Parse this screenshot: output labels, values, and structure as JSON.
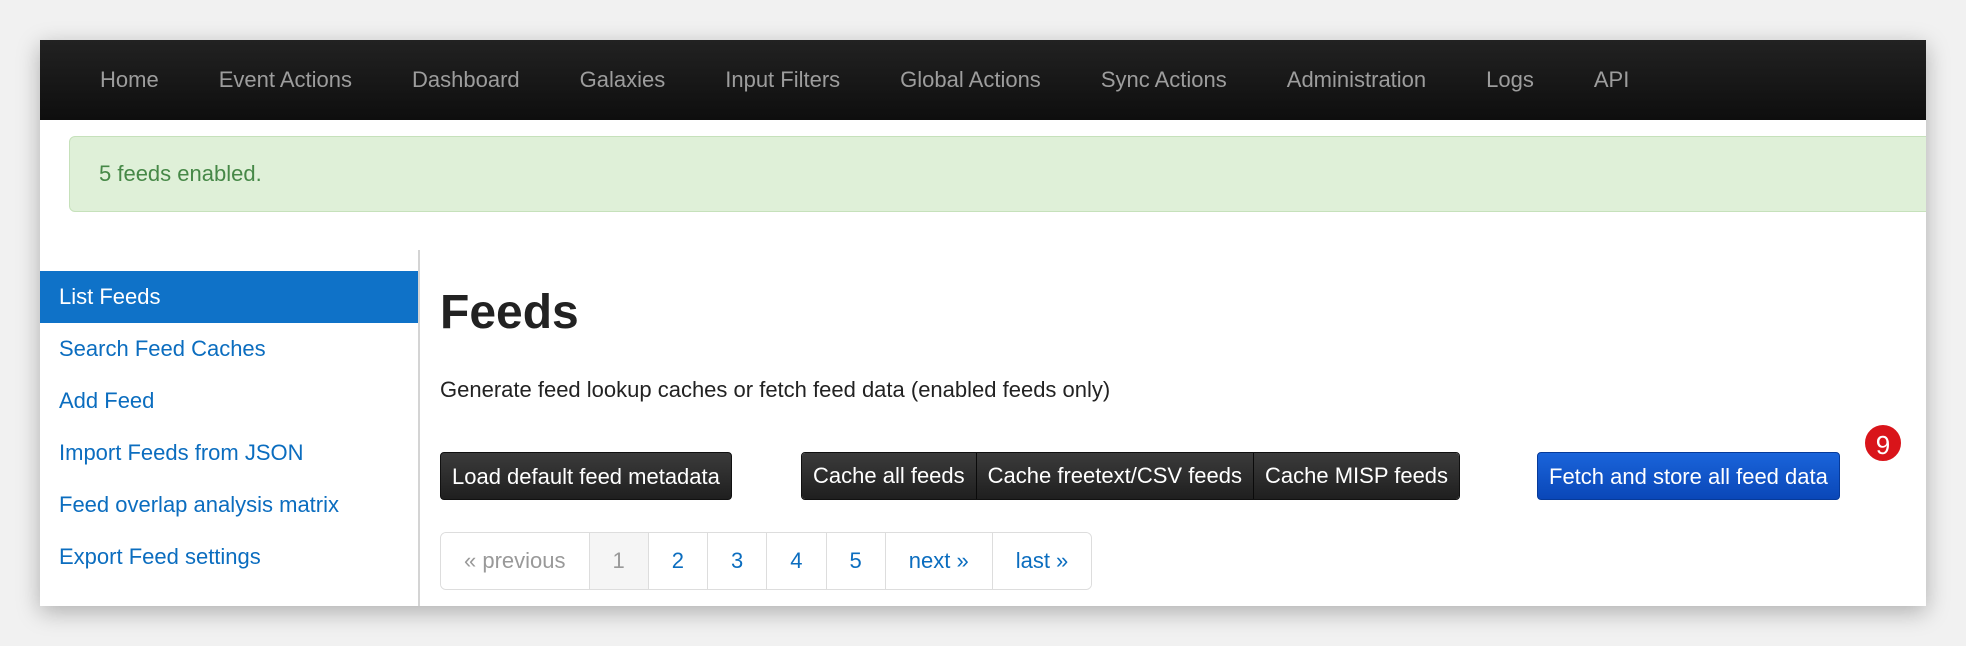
{
  "navbar": {
    "items": [
      {
        "label": "Home"
      },
      {
        "label": "Event Actions"
      },
      {
        "label": "Dashboard"
      },
      {
        "label": "Galaxies"
      },
      {
        "label": "Input Filters"
      },
      {
        "label": "Global Actions"
      },
      {
        "label": "Sync Actions"
      },
      {
        "label": "Administration"
      },
      {
        "label": "Logs"
      },
      {
        "label": "API"
      }
    ]
  },
  "alert": {
    "message": "5 feeds enabled.",
    "status_color": "#dff0d8"
  },
  "sidebar": {
    "active_color": "#0f72c8",
    "items": [
      {
        "label": "List Feeds",
        "active": true
      },
      {
        "label": "Search Feed Caches"
      },
      {
        "label": "Add Feed"
      },
      {
        "label": "Import Feeds from JSON"
      },
      {
        "label": "Feed overlap analysis matrix"
      },
      {
        "label": "Export Feed settings"
      }
    ]
  },
  "main": {
    "title": "Feeds",
    "description": "Generate feed lookup caches or fetch feed data (enabled feeds only)",
    "buttons": {
      "load_default": "Load default feed metadata",
      "cache_all": "Cache all feeds",
      "cache_freetext": "Cache freetext/CSV feeds",
      "cache_misp": "Cache MISP feeds",
      "fetch_all": "Fetch and store all feed data"
    },
    "badge_count": "9",
    "pagination": {
      "previous": "« previous",
      "pages": [
        "1",
        "2",
        "3",
        "4",
        "5"
      ],
      "current_page": "1",
      "next": "next »",
      "last": "last »"
    }
  }
}
